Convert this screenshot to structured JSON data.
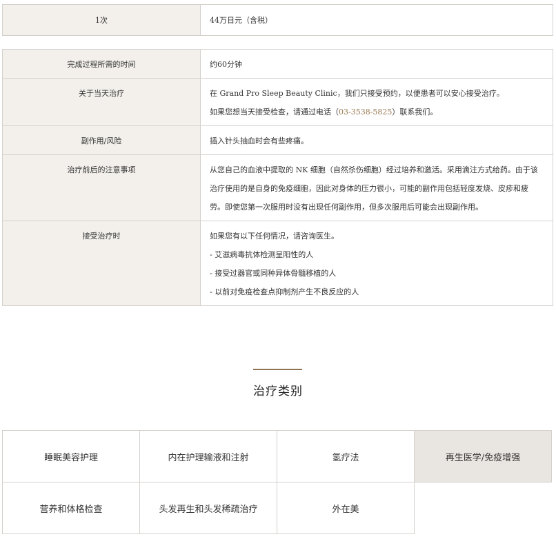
{
  "price_row": {
    "label": "1次",
    "value": "44万日元（含税）"
  },
  "details": {
    "duration": {
      "label": "完成过程所需的时间",
      "value": "约60分钟"
    },
    "same_day": {
      "label": "关于当天治疗",
      "line1": "在 Grand Pro Sleep Beauty Clinic，我们只接受预约，以便患者可以安心接受治疗。",
      "line2_prefix": "如果您想当天接受检查，请通过电话（",
      "phone": "03-3538-5825",
      "line2_suffix": "）联系我们。"
    },
    "side_effects": {
      "label": "副作用/风险",
      "value": "插入针头抽血时会有些疼痛。"
    },
    "precautions": {
      "label": "治疗前后的注意事项",
      "value": "从您自己的血液中提取的 NK 细胞（自然杀伤细胞）经过培养和激活。采用滴注方式给药。由于该治疗使用的是自身的免疫细胞，因此对身体的压力很小，可能的副作用包括轻度发烧、皮疹和疲劳。即使您第一次服用时没有出现任何副作用，但多次服用后可能会出现副作用。"
    },
    "when_receiving": {
      "label": "接受治疗时",
      "intro": "如果您有以下任何情况，请咨询医生。",
      "items": [
        "- 艾滋病毒抗体检测呈阳性的人",
        "- 接受过器官或同种异体骨髓移植的人",
        "- 以前对免疫检查点抑制剂产生不良反应的人"
      ]
    }
  },
  "section": {
    "title": "治疗类别"
  },
  "categories": [
    {
      "label": "睡眠美容护理",
      "active": false
    },
    {
      "label": "内在护理输液和注射",
      "active": false
    },
    {
      "label": "氢疗法",
      "active": false
    },
    {
      "label": "再生医学/免疫增强",
      "active": true
    },
    {
      "label": "营养和体格检查",
      "active": false
    },
    {
      "label": "头发再生和头发稀疏治疗",
      "active": false
    },
    {
      "label": "外在美",
      "active": false
    }
  ],
  "colors": {
    "label_bg": "#f3f0ec",
    "border": "#d4d0cc",
    "accent": "#8c7251",
    "phone_link": "#9a7a52",
    "active_category_bg": "#e9e5e0"
  }
}
